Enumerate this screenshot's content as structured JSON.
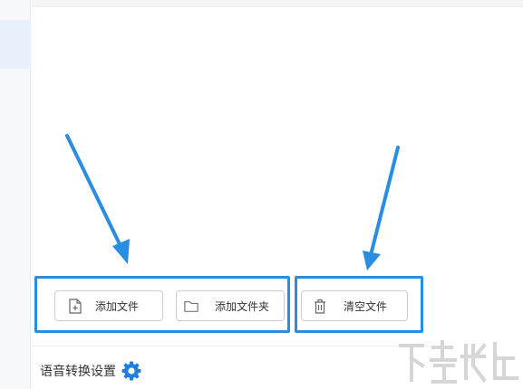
{
  "toolbar": {
    "add_file_label": "添加文件",
    "add_folder_label": "添加文件夹",
    "clear_files_label": "清空文件"
  },
  "settings": {
    "title": "语音转换设置"
  },
  "colors": {
    "highlight": "#2b8de0",
    "arrow": "#2b8de0",
    "gear": "#1e7fe0"
  },
  "icons": {
    "add_file": "file-plus-icon",
    "add_folder": "folder-icon",
    "clear": "trash-icon",
    "settings": "gear-icon"
  }
}
